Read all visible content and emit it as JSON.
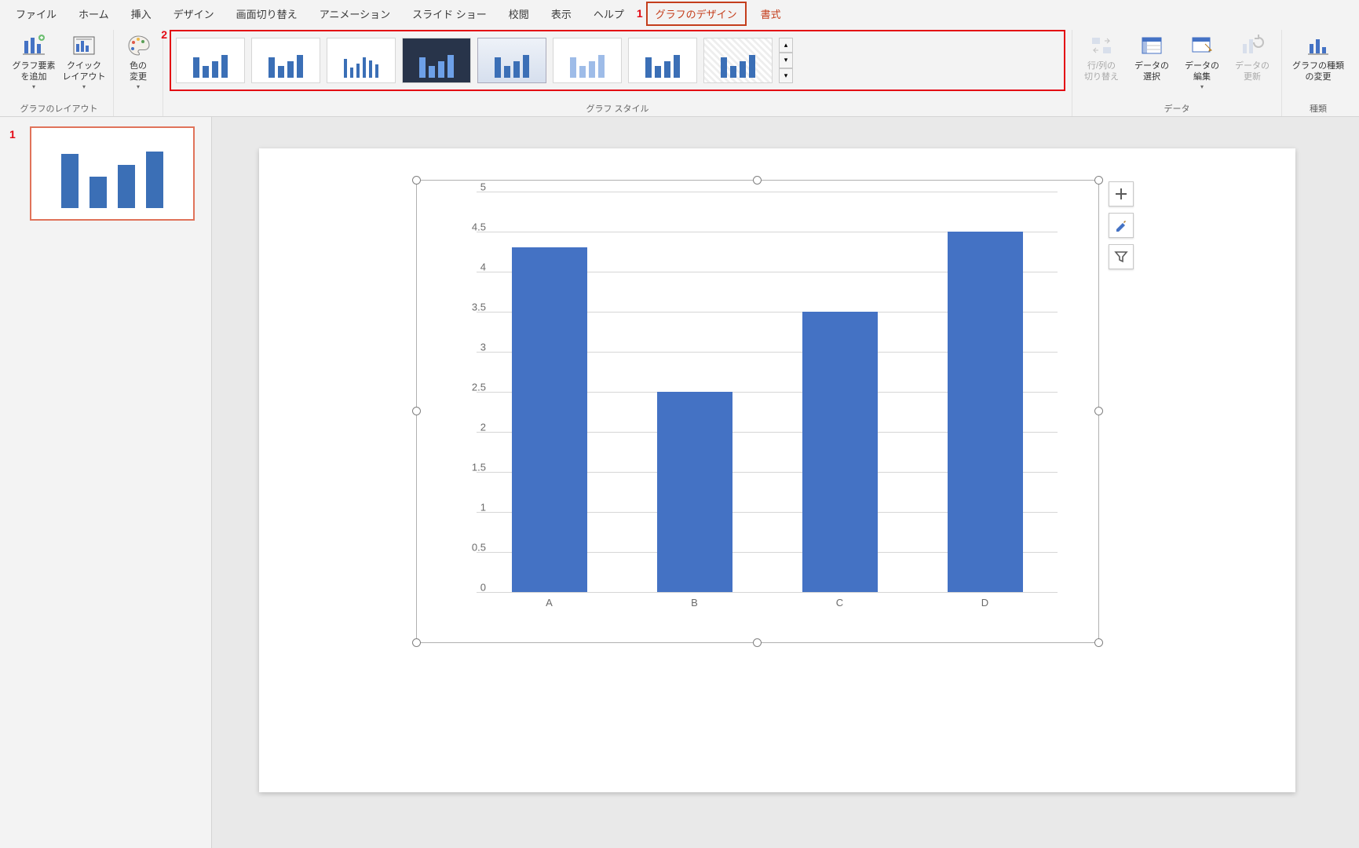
{
  "ribbon": {
    "tabs": [
      "ファイル",
      "ホーム",
      "挿入",
      "デザイン",
      "画面切り替え",
      "アニメーション",
      "スライド ショー",
      "校閲",
      "表示",
      "ヘルプ",
      "グラフのデザイン",
      "書式"
    ],
    "active_tab_index": 10,
    "layout_group": {
      "add_element": "グラフ要素\nを追加",
      "quick_layout": "クイック\nレイアウト",
      "label": "グラフのレイアウト"
    },
    "color_change": "色の\n変更",
    "styles_group": {
      "label": "グラフ スタイル"
    },
    "data_group": {
      "switch_rc": "行/列の\n切り替え",
      "select_data": "データの\n選択",
      "edit_data": "データの\n編集",
      "refresh": "データの\n更新",
      "label": "データ"
    },
    "type_group": {
      "change_type": "グラフの種類\nの変更",
      "label": "種類"
    }
  },
  "callouts": {
    "tab": "1",
    "gallery": "2"
  },
  "slides": {
    "numbers": [
      "1"
    ]
  },
  "chart_data": {
    "type": "bar",
    "categories": [
      "A",
      "B",
      "C",
      "D"
    ],
    "values": [
      4.3,
      2.5,
      3.5,
      4.5
    ],
    "ylim": [
      0,
      5
    ],
    "ytick_step": 0.5,
    "yticks": [
      "0",
      "0.5",
      "1",
      "1.5",
      "2",
      "2.5",
      "3",
      "3.5",
      "4",
      "4.5",
      "5"
    ],
    "title": "",
    "xlabel": "",
    "ylabel": ""
  },
  "colors": {
    "accent": "#c43e1c",
    "bar": "#4472c4",
    "callout": "#e30613"
  }
}
